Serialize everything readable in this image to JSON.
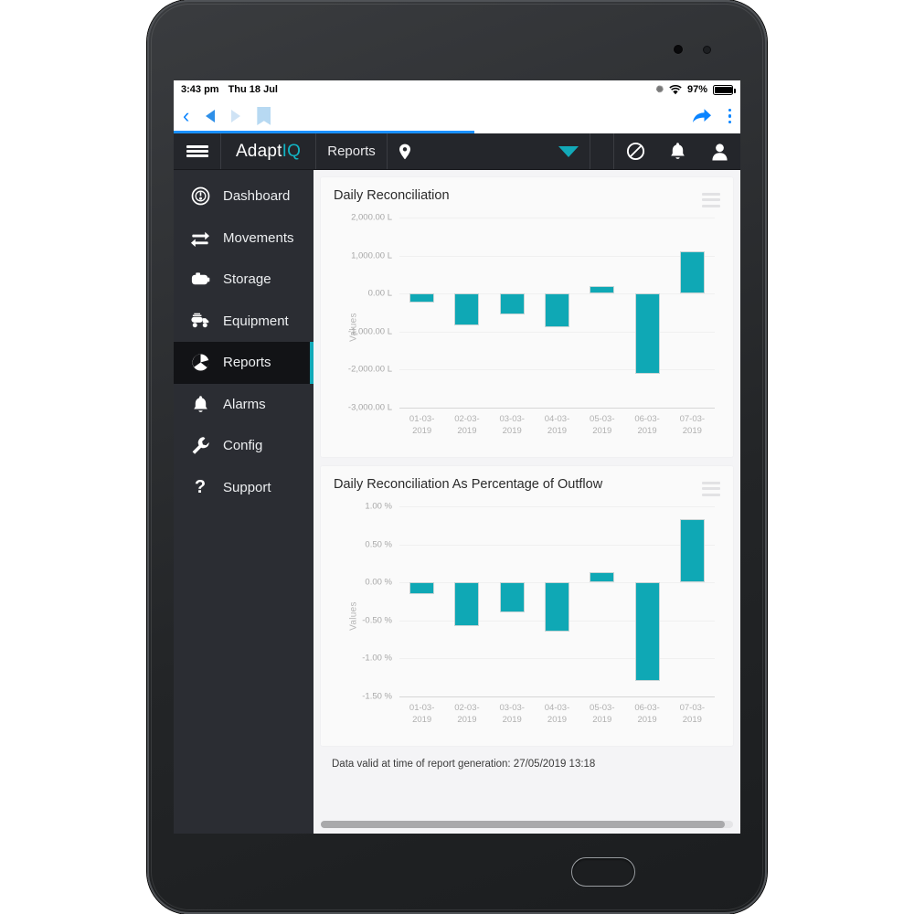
{
  "status_bar": {
    "time": "3:43 pm",
    "date": "Thu 18 Jul",
    "battery_percent": "97%",
    "bluetooth_icon": "bluetooth-icon",
    "wifi_icon": "wifi-icon",
    "battery_icon": "battery-icon"
  },
  "browser_bar": {
    "back_chevron_icon": "chevron-left-icon",
    "nav_back_icon": "triangle-back-icon",
    "nav_forward_icon": "triangle-forward-icon",
    "bookmark_icon": "bookmark-icon",
    "share_icon": "share-icon",
    "more_icon": "more-vertical-icon",
    "progress_percent": 53
  },
  "app_header": {
    "menu_icon": "hamburger-menu-icon",
    "brand_main": "Adapt",
    "brand_accent": "IQ",
    "section_label": "Reports",
    "location_icon": "map-pin-icon",
    "location_value": "",
    "location_caret_icon": "caret-down-icon",
    "icons": [
      {
        "name": "block-icon",
        "label": ""
      },
      {
        "name": "bell-icon",
        "label": ""
      },
      {
        "name": "user-icon",
        "label": ""
      }
    ]
  },
  "sidebar": {
    "items": [
      {
        "label": "Dashboard",
        "icon": "gauge-icon",
        "active": false
      },
      {
        "label": "Movements",
        "icon": "transfer-arrows-icon",
        "active": false
      },
      {
        "label": "Storage",
        "icon": "tank-icon",
        "active": false
      },
      {
        "label": "Equipment",
        "icon": "tanker-truck-icon",
        "active": false
      },
      {
        "label": "Reports",
        "icon": "pie-chart-icon",
        "active": true
      },
      {
        "label": "Alarms",
        "icon": "bell-icon",
        "active": false
      },
      {
        "label": "Config",
        "icon": "wrench-icon",
        "active": false
      },
      {
        "label": "Support",
        "icon": "question-mark-icon",
        "active": false
      }
    ]
  },
  "cards": [
    {
      "title": "Daily Reconciliation",
      "menu_icon": "card-menu-icon"
    },
    {
      "title": "Daily Reconciliation As Percentage of Outflow",
      "menu_icon": "card-menu-icon"
    }
  ],
  "footer": {
    "note": "Data valid at time of report generation: 27/05/2019 13:18"
  },
  "colors": {
    "accent_teal": "#12a9b8",
    "bar_teal": "#0fa8b5",
    "header_dark": "#24262b",
    "sidebar_dark": "#2b2d33",
    "sidebar_active": "#121316",
    "content_bg": "#f4f4f6",
    "browser_blue": "#0a84ff"
  },
  "chart_data": [
    {
      "type": "bar",
      "title": "Daily Reconciliation",
      "xlabel": "",
      "ylabel": "Values",
      "categories": [
        "01-03-2019",
        "02-03-2019",
        "03-03-2019",
        "04-03-2019",
        "05-03-2019",
        "06-03-2019",
        "07-03-2019"
      ],
      "values": [
        -230,
        -840,
        -560,
        -880,
        190,
        -2100,
        1120
      ],
      "ylim": [
        -3000,
        2000
      ],
      "yticks": [
        2000,
        1000,
        0,
        -1000,
        -2000,
        -3000
      ],
      "ytick_labels": [
        "2,000.00 L",
        "1,000.00 L",
        "0.00 L",
        "-1,000.00 L",
        "-2,000.00 L",
        "-3,000.00 L"
      ],
      "unit": "L",
      "grid": true,
      "legend": "none"
    },
    {
      "type": "bar",
      "title": "Daily Reconciliation As Percentage of Outflow",
      "xlabel": "",
      "ylabel": "Values",
      "categories": [
        "01-03-2019",
        "02-03-2019",
        "03-03-2019",
        "04-03-2019",
        "05-03-2019",
        "06-03-2019",
        "07-03-2019"
      ],
      "values": [
        -0.16,
        -0.57,
        -0.39,
        -0.65,
        0.13,
        -1.3,
        0.83
      ],
      "ylim": [
        -1.5,
        1.0
      ],
      "yticks": [
        1.0,
        0.5,
        0,
        -0.5,
        -1.0,
        -1.5
      ],
      "ytick_labels": [
        "1.00 %",
        "0.50 %",
        "0.00 %",
        "-0.50 %",
        "-1.00 %",
        "-1.50 %"
      ],
      "unit": "%",
      "grid": true,
      "legend": "none"
    }
  ]
}
